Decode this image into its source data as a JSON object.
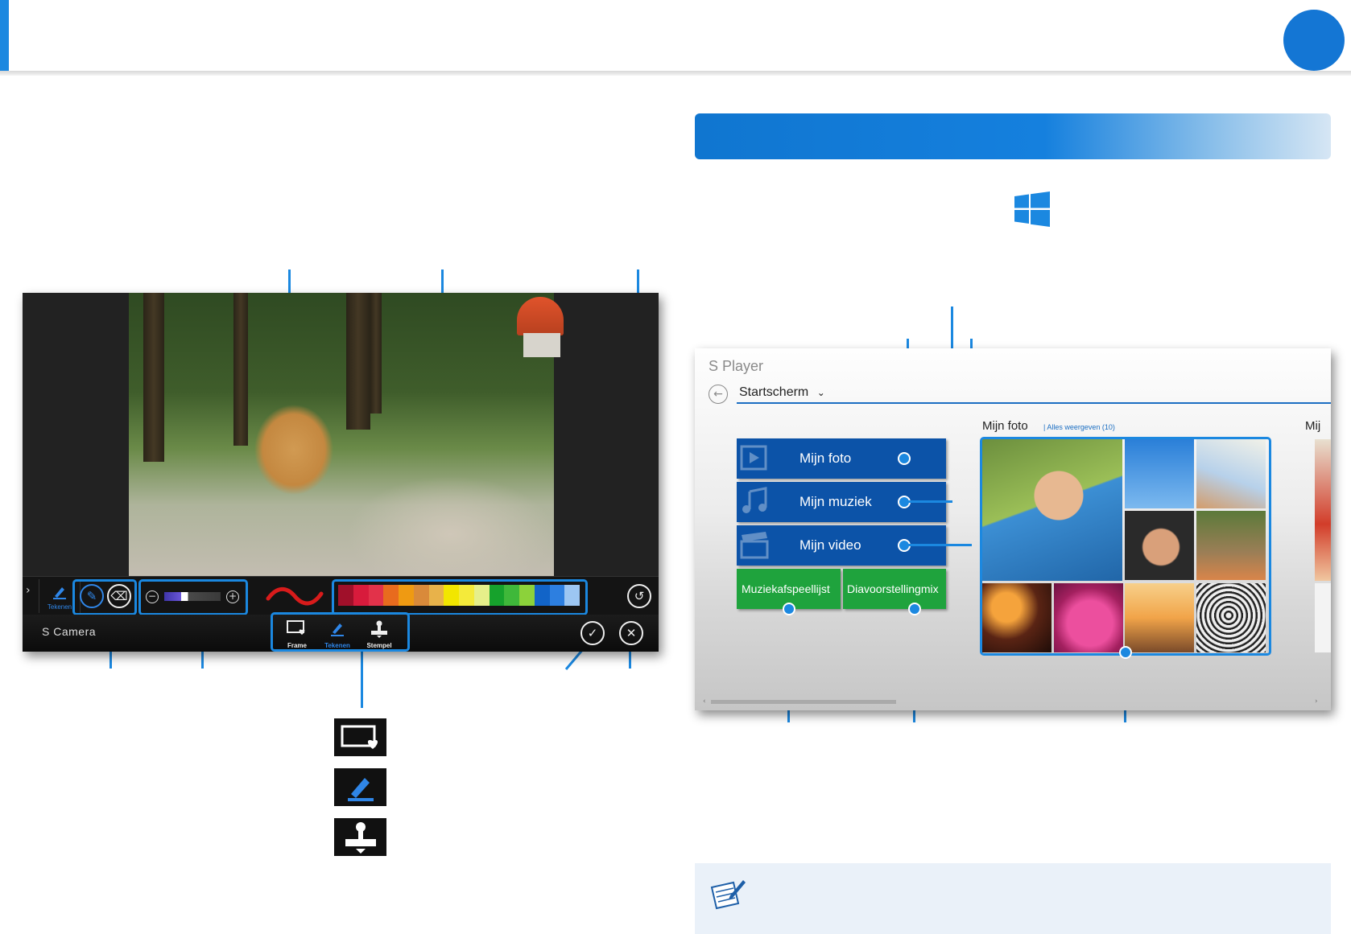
{
  "camera": {
    "app_title": "S Camera",
    "toolbar": {
      "left_tool_label": "Tekenen",
      "tabs": [
        {
          "label": "Frame",
          "icon": "frame-heart-icon"
        },
        {
          "label": "Tekenen",
          "icon": "pen-icon"
        },
        {
          "label": "Stempel",
          "icon": "stamp-icon"
        }
      ],
      "palette": [
        "#a0102a",
        "#d81b3c",
        "#e2324a",
        "#e86b1e",
        "#ef9a12",
        "#d98a3a",
        "#e8b24a",
        "#f2e600",
        "#f4ea3a",
        "#e6ef8a",
        "#16a22c",
        "#3fb83a",
        "#8cd23a",
        "#1264c8",
        "#2d7fe0",
        "#9cc6f2"
      ],
      "accent_color": "#1b88e0"
    }
  },
  "player": {
    "app_title": "S Player",
    "nav_current": "Startscherm",
    "tiles": [
      {
        "label": "Mijn foto",
        "icon": "play-icon",
        "color": "#0c53a8"
      },
      {
        "label": "Mijn muziek",
        "icon": "music-note-icon",
        "color": "#0c53a8"
      },
      {
        "label": "Mijn video",
        "icon": "clapperboard-icon",
        "color": "#0c53a8"
      }
    ],
    "green_tiles": [
      {
        "label": "Muziekafspeellijst",
        "color": "#1fa33d"
      },
      {
        "label": "Diavoorstellingmix",
        "color": "#1fa33d"
      }
    ],
    "photos_section_title": "Mijn foto",
    "photos_link": "| Alles weergeven (10)",
    "next_section_title": "Mij"
  }
}
